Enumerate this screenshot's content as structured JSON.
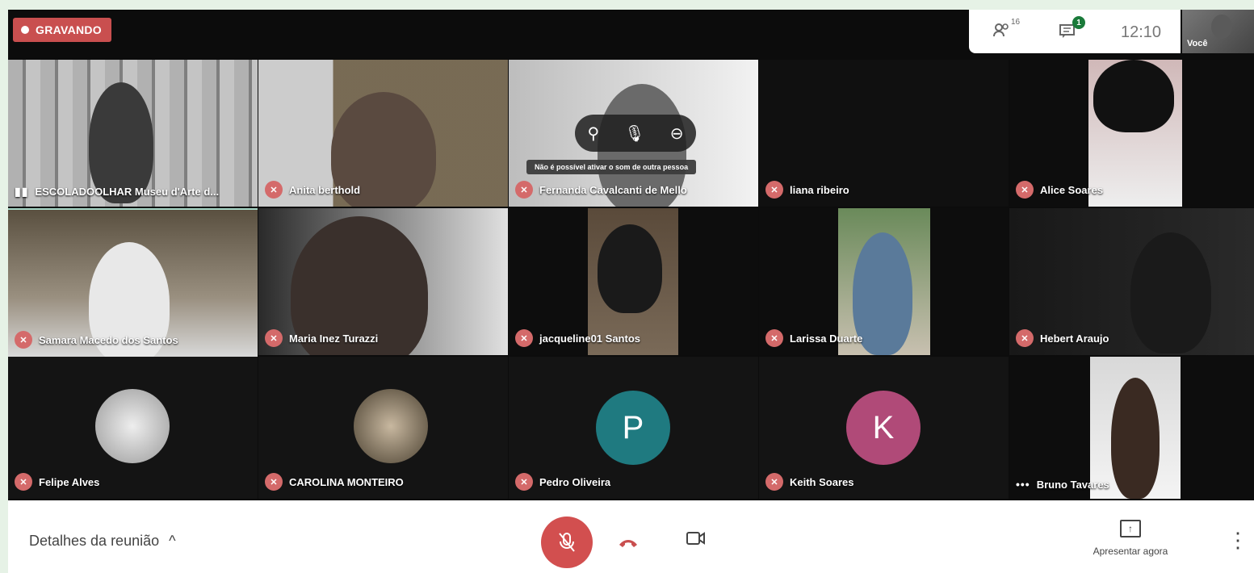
{
  "recording": {
    "label": "GRAVANDO"
  },
  "topbar": {
    "participants_icon": "people-icon",
    "participants_count": "16",
    "chat_icon": "chat-icon",
    "chat_badge": "1",
    "time": "12:10",
    "self_label": "Você"
  },
  "hover_controls": {
    "pin_icon": "pin-icon",
    "mute_icon": "mic-off-icon",
    "remove_icon": "remove-icon",
    "tooltip": "Não é possível ativar o som de outra pessoa"
  },
  "participants": [
    {
      "name": "ESCOLADOOLHAR Museu d'Arte d...",
      "indicator": "audio-bars"
    },
    {
      "name": "Anita berthold",
      "indicator": "muted"
    },
    {
      "name": "Fernanda Cavalcanti de Mello",
      "indicator": "muted"
    },
    {
      "name": "liana ribeiro",
      "indicator": "muted"
    },
    {
      "name": "Alice Soares",
      "indicator": "muted"
    },
    {
      "name": "Samara Macedo dos Santos",
      "indicator": "muted"
    },
    {
      "name": "Maria Inez Turazzi",
      "indicator": "muted"
    },
    {
      "name": "jacqueline01 Santos",
      "indicator": "muted"
    },
    {
      "name": "Larissa Duarte",
      "indicator": "muted"
    },
    {
      "name": "Hebert Araujo",
      "indicator": "muted"
    },
    {
      "name": "Felipe Alves",
      "indicator": "muted"
    },
    {
      "name": "CAROLINA MONTEIRO",
      "indicator": "muted"
    },
    {
      "name": "Pedro Oliveira",
      "indicator": "muted",
      "initial": "P",
      "color": "#1f7a80"
    },
    {
      "name": "Keith Soares",
      "indicator": "muted",
      "initial": "K",
      "color": "#b04a78"
    },
    {
      "name": "Bruno Tavares",
      "indicator": "speaking-dots"
    }
  ],
  "bottombar": {
    "details_label": "Detalhes da reunião",
    "details_chevron": "^",
    "mic_icon": "mic-off-icon",
    "hangup_icon": "hangup-icon",
    "camera_icon": "camera-icon",
    "present_label": "Apresentar agora",
    "more_icon": "more-vert-icon"
  },
  "colors": {
    "accent_red": "#c94f4f",
    "mute_red": "#d46a6a"
  }
}
